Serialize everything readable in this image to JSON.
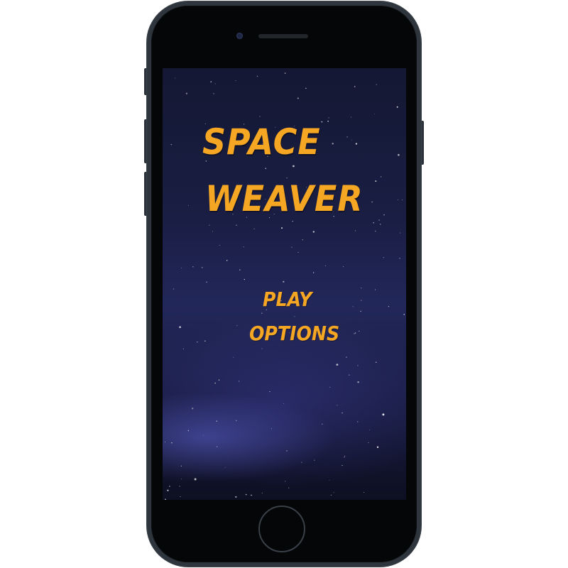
{
  "game": {
    "title_line1": "SPACE",
    "title_line2": "WEAVER",
    "menu": {
      "play_label": "PLAY",
      "options_label": "OPTIONS"
    }
  },
  "colors": {
    "title_color": "#f5a623",
    "background_top": "#141833",
    "background_mid": "#22275a",
    "phone_frame": "#2e353d"
  },
  "icons": {
    "background": "starfield-background",
    "device": "smartphone-frame"
  }
}
